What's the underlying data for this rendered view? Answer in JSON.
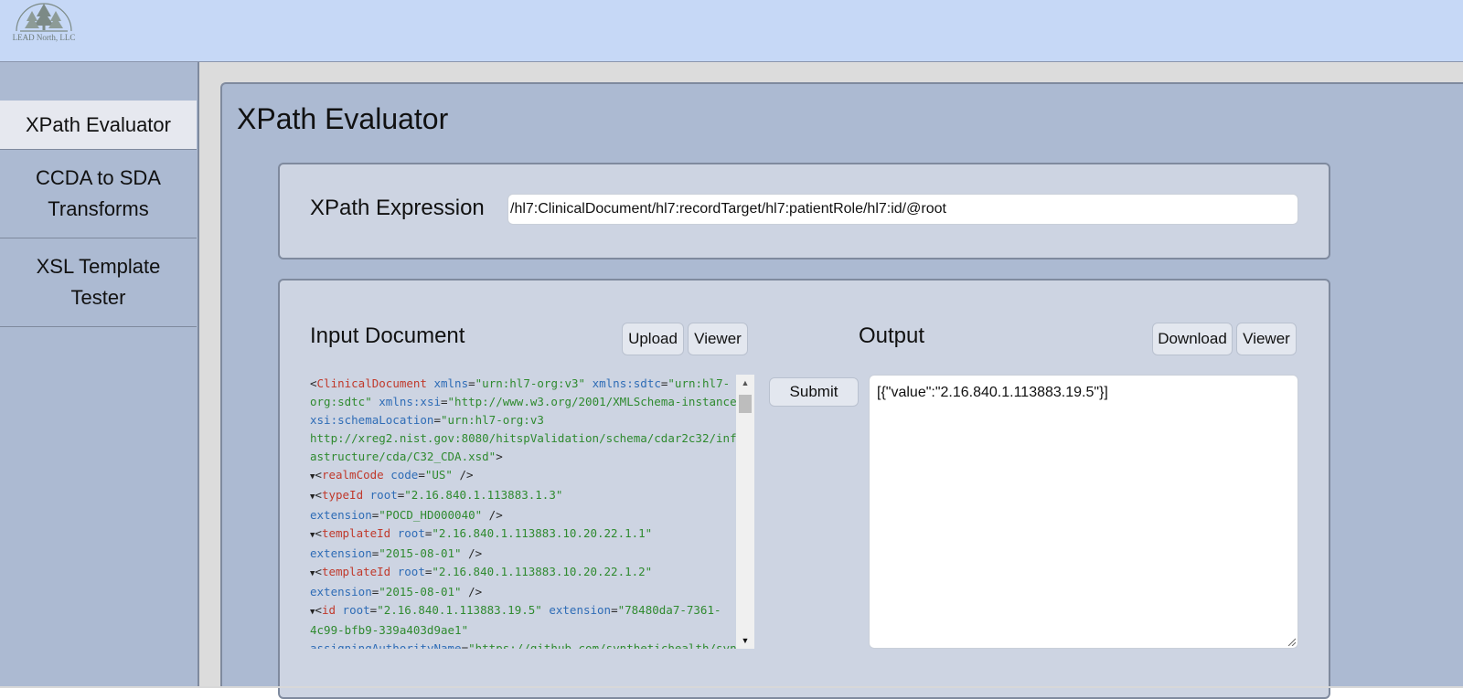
{
  "header": {
    "logo_text": "LEAD North, LLC"
  },
  "sidebar": {
    "items": [
      {
        "line1": "XPath Evaluator",
        "line2": "",
        "active": true
      },
      {
        "line1": "CCDA to SDA",
        "line2": "Transforms",
        "active": false
      },
      {
        "line1": "XSL Template",
        "line2": "Tester",
        "active": false
      }
    ]
  },
  "page": {
    "title": "XPath Evaluator"
  },
  "xpath": {
    "label": "XPath Expression",
    "value": "/hl7:ClinicalDocument/hl7:recordTarget/hl7:patientRole/hl7:id/@root"
  },
  "input_doc": {
    "heading": "Input Document",
    "upload_label": "Upload",
    "viewer_label": "Viewer",
    "lines": [
      [
        [
          "punc",
          "<"
        ],
        [
          "tag",
          "ClinicalDocument"
        ],
        [
          "punc",
          " "
        ],
        [
          "attr",
          "xmlns"
        ],
        [
          "punc",
          "="
        ],
        [
          "val",
          "\"urn:hl7-org:v3\""
        ],
        [
          "punc",
          " "
        ],
        [
          "attr",
          "xmlns:sdtc"
        ],
        [
          "punc",
          "="
        ],
        [
          "val",
          "\"urn:hl7-"
        ]
      ],
      [
        [
          "val",
          "org:sdtc\""
        ],
        [
          "punc",
          " "
        ],
        [
          "attr",
          "xmlns:xsi"
        ],
        [
          "punc",
          "="
        ],
        [
          "val",
          "\"http://www.w3.org/2001/XMLSchema-instance\""
        ]
      ],
      [
        [
          "attr",
          "xsi:schemaLocation"
        ],
        [
          "punc",
          "="
        ],
        [
          "val",
          "\"urn:hl7-org:v3"
        ]
      ],
      [
        [
          "val",
          "http://xreg2.nist.gov:8080/hitspValidation/schema/cdar2c32/infr"
        ]
      ],
      [
        [
          "val",
          "astructure/cda/C32_CDA.xsd\""
        ],
        [
          "punc",
          ">"
        ]
      ],
      [
        [
          "tri",
          "▼"
        ],
        [
          "punc",
          "<"
        ],
        [
          "tag",
          "realmCode"
        ],
        [
          "punc",
          " "
        ],
        [
          "attr",
          "code"
        ],
        [
          "punc",
          "="
        ],
        [
          "val",
          "\"US\""
        ],
        [
          "punc",
          " />"
        ]
      ],
      [
        [
          "tri",
          "▼"
        ],
        [
          "punc",
          "<"
        ],
        [
          "tag",
          "typeId"
        ],
        [
          "punc",
          " "
        ],
        [
          "attr",
          "root"
        ],
        [
          "punc",
          "="
        ],
        [
          "val",
          "\"2.16.840.1.113883.1.3\""
        ]
      ],
      [
        [
          "attr",
          "extension"
        ],
        [
          "punc",
          "="
        ],
        [
          "val",
          "\"POCD_HD000040\""
        ],
        [
          "punc",
          " />"
        ]
      ],
      [
        [
          "tri",
          "▼"
        ],
        [
          "punc",
          "<"
        ],
        [
          "tag",
          "templateId"
        ],
        [
          "punc",
          " "
        ],
        [
          "attr",
          "root"
        ],
        [
          "punc",
          "="
        ],
        [
          "val",
          "\"2.16.840.1.113883.10.20.22.1.1\""
        ]
      ],
      [
        [
          "attr",
          "extension"
        ],
        [
          "punc",
          "="
        ],
        [
          "val",
          "\"2015-08-01\""
        ],
        [
          "punc",
          " />"
        ]
      ],
      [
        [
          "tri",
          "▼"
        ],
        [
          "punc",
          "<"
        ],
        [
          "tag",
          "templateId"
        ],
        [
          "punc",
          " "
        ],
        [
          "attr",
          "root"
        ],
        [
          "punc",
          "="
        ],
        [
          "val",
          "\"2.16.840.1.113883.10.20.22.1.2\""
        ]
      ],
      [
        [
          "attr",
          "extension"
        ],
        [
          "punc",
          "="
        ],
        [
          "val",
          "\"2015-08-01\""
        ],
        [
          "punc",
          " />"
        ]
      ],
      [
        [
          "tri",
          "▼"
        ],
        [
          "punc",
          "<"
        ],
        [
          "tag",
          "id"
        ],
        [
          "punc",
          " "
        ],
        [
          "attr",
          "root"
        ],
        [
          "punc",
          "="
        ],
        [
          "val",
          "\"2.16.840.1.113883.19.5\""
        ],
        [
          "punc",
          " "
        ],
        [
          "attr",
          "extension"
        ],
        [
          "punc",
          "="
        ],
        [
          "val",
          "\"78480da7-7361-"
        ]
      ],
      [
        [
          "val",
          "4c99-bfb9-339a403d9ae1\""
        ]
      ],
      [
        [
          "attr",
          "assigningAuthorityName"
        ],
        [
          "punc",
          "="
        ],
        [
          "val",
          "\"https://github.com/synthetichealth/synt"
        ]
      ]
    ]
  },
  "submit_label": "Submit",
  "output": {
    "heading": "Output",
    "download_label": "Download",
    "viewer_label": "Viewer",
    "value": "[{\"value\":\"2.16.840.1.113883.19.5\"}]"
  }
}
